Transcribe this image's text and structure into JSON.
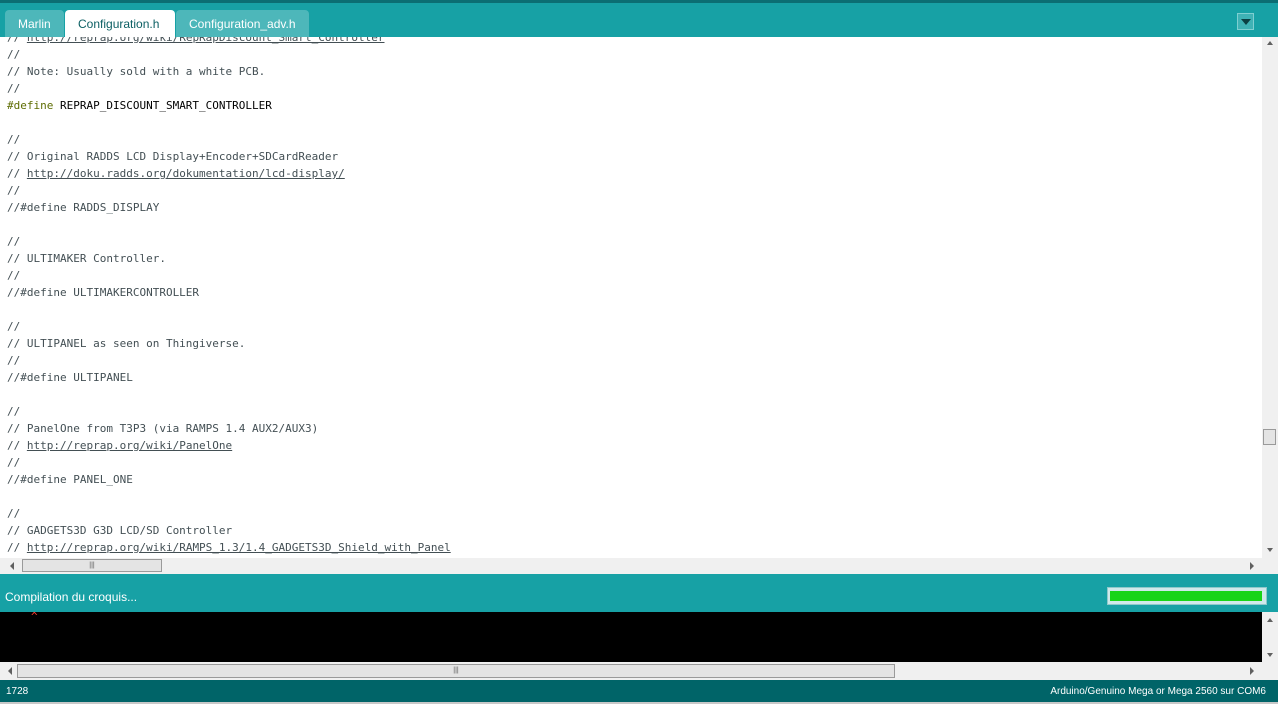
{
  "tabs": [
    {
      "label": "Marlin",
      "active": false
    },
    {
      "label": "Configuration.h",
      "active": true
    },
    {
      "label": "Configuration_adv.h",
      "active": false
    }
  ],
  "editor": {
    "lines": [
      [
        {
          "t": "// "
        },
        {
          "t": "http://reprap.org/wiki/RepRapDiscount_Smart_Controller",
          "c": "url"
        }
      ],
      [
        {
          "t": "//"
        }
      ],
      [
        {
          "t": "// Note: Usually sold with a white PCB."
        }
      ],
      [
        {
          "t": "//"
        }
      ],
      [
        {
          "t": "#define",
          "c": "kw"
        },
        {
          "t": " REPRAP_DISCOUNT_SMART_CONTROLLER",
          "c": "dark"
        }
      ],
      [
        {
          "t": ""
        }
      ],
      [
        {
          "t": "//"
        }
      ],
      [
        {
          "t": "// Original RADDS LCD Display+Encoder+SDCardReader"
        }
      ],
      [
        {
          "t": "// "
        },
        {
          "t": "http://doku.radds.org/dokumentation/lcd-display/",
          "c": "url"
        }
      ],
      [
        {
          "t": "//"
        }
      ],
      [
        {
          "t": "//#define RADDS_DISPLAY"
        }
      ],
      [
        {
          "t": ""
        }
      ],
      [
        {
          "t": "//"
        }
      ],
      [
        {
          "t": "// ULTIMAKER Controller."
        }
      ],
      [
        {
          "t": "//"
        }
      ],
      [
        {
          "t": "//#define ULTIMAKERCONTROLLER"
        }
      ],
      [
        {
          "t": ""
        }
      ],
      [
        {
          "t": "//"
        }
      ],
      [
        {
          "t": "// ULTIPANEL as seen on Thingiverse."
        }
      ],
      [
        {
          "t": "//"
        }
      ],
      [
        {
          "t": "//#define ULTIPANEL"
        }
      ],
      [
        {
          "t": ""
        }
      ],
      [
        {
          "t": "//"
        }
      ],
      [
        {
          "t": "// PanelOne from T3P3 (via RAMPS 1.4 AUX2/AUX3)"
        }
      ],
      [
        {
          "t": "// "
        },
        {
          "t": "http://reprap.org/wiki/PanelOne",
          "c": "url"
        }
      ],
      [
        {
          "t": "//"
        }
      ],
      [
        {
          "t": "//#define PANEL_ONE"
        }
      ],
      [
        {
          "t": ""
        }
      ],
      [
        {
          "t": "//"
        }
      ],
      [
        {
          "t": "// GADGETS3D G3D LCD/SD Controller"
        }
      ],
      [
        {
          "t": "// "
        },
        {
          "t": "http://reprap.org/wiki/RAMPS_1.3/1.4_GADGETS3D_Shield_with_Panel",
          "c": "url"
        }
      ]
    ]
  },
  "scrollbar_grip": "|||",
  "status": {
    "message": "Compilation du croquis...",
    "progress": 0.99,
    "progress_color": "#18d418"
  },
  "console": {
    "line": "^"
  },
  "footer": {
    "line_number": "1728",
    "board": "Arduino/Genuino Mega or Mega 2560 sur COM6"
  },
  "colors": {
    "teal": "#17a1a5",
    "footer": "#006468",
    "keyword": "#5e6d03",
    "comment": "#434f54"
  }
}
